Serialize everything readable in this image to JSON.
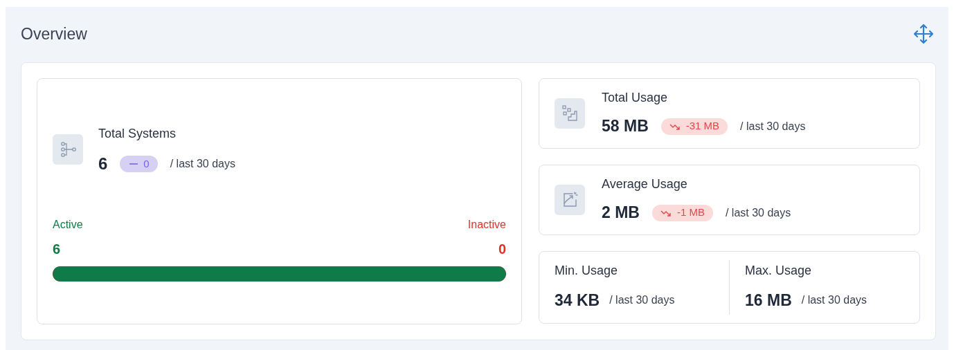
{
  "title": "Overview",
  "systems": {
    "title": "Total Systems",
    "value": "6",
    "trend": {
      "kind": "flat",
      "text": "0"
    },
    "period": "/ last 30 days",
    "active": {
      "label": "Active",
      "value": "6"
    },
    "inactive": {
      "label": "Inactive",
      "value": "0"
    },
    "level": 1
  },
  "usage": [
    {
      "kind": "total",
      "title": "Total Usage",
      "value": "58 MB",
      "trend": {
        "kind": "down",
        "text": "-31 MB"
      },
      "period": "/ last 30 days"
    },
    {
      "kind": "average",
      "title": "Average Usage",
      "value": "2 MB",
      "trend": {
        "kind": "down",
        "text": "-1 MB"
      },
      "period": "/ last 30 days"
    }
  ],
  "extremes": [
    {
      "title": "Min. Usage",
      "value": "34 KB",
      "period": "/ last 30 days"
    },
    {
      "title": "Max. Usage",
      "value": "16 MB",
      "period": "/ last 30 days"
    }
  ]
}
